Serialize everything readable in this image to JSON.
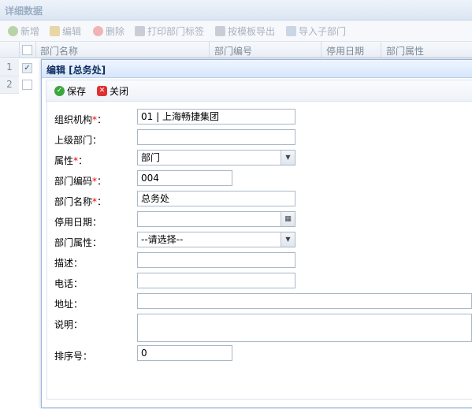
{
  "panel": {
    "title": "详细数据"
  },
  "toolbar": {
    "add": "新增",
    "edit": "编辑",
    "delete": "删除",
    "print_labels": "打印部门标签",
    "export_template": "按模板导出",
    "import_sub": "导入子部门"
  },
  "grid": {
    "columns": [
      "部门名称",
      "部门编号",
      "停用日期",
      "部门属性"
    ],
    "rows": [
      {
        "num": "1",
        "checked": true
      },
      {
        "num": "2",
        "checked": false
      }
    ]
  },
  "dialog": {
    "title": "编辑 [总务处]",
    "save_label": "保存",
    "close_label": "关闭"
  },
  "form": {
    "org": {
      "label": "组织机构",
      "required": "*",
      "suffix": "：",
      "value": "01 | 上海畅捷集团"
    },
    "parent": {
      "label": "上级部门",
      "suffix": "：",
      "value": ""
    },
    "attr": {
      "label": "属性",
      "required": "*",
      "suffix": "：",
      "value": "部门"
    },
    "code": {
      "label": "部门编码",
      "required": "*",
      "suffix": "：",
      "value": "004"
    },
    "name": {
      "label": "部门名称",
      "required": "*",
      "suffix": "：",
      "value": "总务处"
    },
    "stop_date": {
      "label": "停用日期",
      "suffix": "：",
      "value": ""
    },
    "dept_attr": {
      "label": "部门属性",
      "suffix": "：",
      "value": "--请选择--"
    },
    "desc": {
      "label": "描述",
      "suffix": "：",
      "value": ""
    },
    "phone": {
      "label": "电话",
      "suffix": "：",
      "value": ""
    },
    "address": {
      "label": "地址",
      "suffix": "：",
      "value": ""
    },
    "note": {
      "label": "说明",
      "suffix": "：",
      "value": ""
    },
    "order": {
      "label": "排序号",
      "suffix": "：",
      "value": "0"
    }
  },
  "colors": {
    "accent": "#95b8e7",
    "title": "#0e2d5f",
    "required": "#ee0000"
  }
}
